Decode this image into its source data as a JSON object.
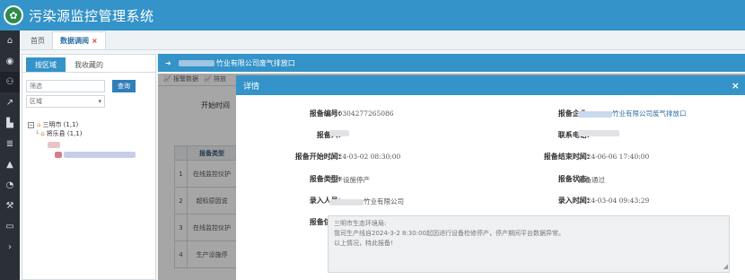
{
  "app": {
    "title": "污染源监控管理系统",
    "logo_icon": "leaf-logo"
  },
  "rail": {
    "icons": [
      "home-icon",
      "globe-icon",
      "binoculars-icon",
      "line-chart-icon",
      "bar-chart-icon",
      "database-icon",
      "warning-icon",
      "pie-chart-icon",
      "gavel-icon",
      "monitor-icon",
      "circle-arrow-icon"
    ]
  },
  "tabs": {
    "home": "首页",
    "current": "数据调阅",
    "close": "×"
  },
  "left_panel": {
    "tab_by_area": "按区域",
    "tab_favorites": "我收藏的",
    "search_placeholder": "筛选",
    "search_button": "查询",
    "region_select": "区域",
    "tree_city": "三明市 (1,1)",
    "tree_county": "将乐县 (1,1)"
  },
  "main": {
    "header_arrow": "➜",
    "header_suffix": "竹业有限公司废气排放口",
    "subtab_1": "报警数据",
    "subtab_2": "排放",
    "start_time_label": "开始时间",
    "table_header": "报备类型",
    "rows": [
      {
        "num": "1",
        "text": "在线监控仪护"
      },
      {
        "num": "2",
        "text": "超标原因说"
      },
      {
        "num": "3",
        "text": "在线监控仪护"
      },
      {
        "num": "4",
        "text": "生产设施停"
      }
    ]
  },
  "modal": {
    "title": "详情",
    "close": "×",
    "fields": {
      "report_no_label": "报备编号:",
      "report_no": "240304277265086",
      "company_label": "报备企业:",
      "company_suffix": "竹业有限公司废气排放口",
      "reporter_label": "报备人:",
      "phone_label": "联系电话:",
      "start_label": "报备开始时间:",
      "start_time": "2024-03-02 08:30:00",
      "end_label": "报备结束时间:",
      "end_time": "2024-06-06 17:40:00",
      "type_label": "报备类型:",
      "type": "生产设施停产",
      "status_label": "报备状态:",
      "status": "报备通过",
      "entry_person_label": "录入人员:",
      "entry_person_suffix": "竹业有限公司",
      "entry_time_label": "录入时间:",
      "entry_time": "2024-03-04 09:43:29",
      "info_label": "报备信息:",
      "info_lines": [
        "三明市生态环境局:",
        "    我司生产线自2024-3-2 8:30:00起因进行设备检修停产，停产期间平台数据异常。",
        "以上情况，特此报备!"
      ]
    }
  },
  "colors": {
    "primary": "#3493c8",
    "rail": "#2b2f36",
    "link": "#2c6ea3"
  }
}
